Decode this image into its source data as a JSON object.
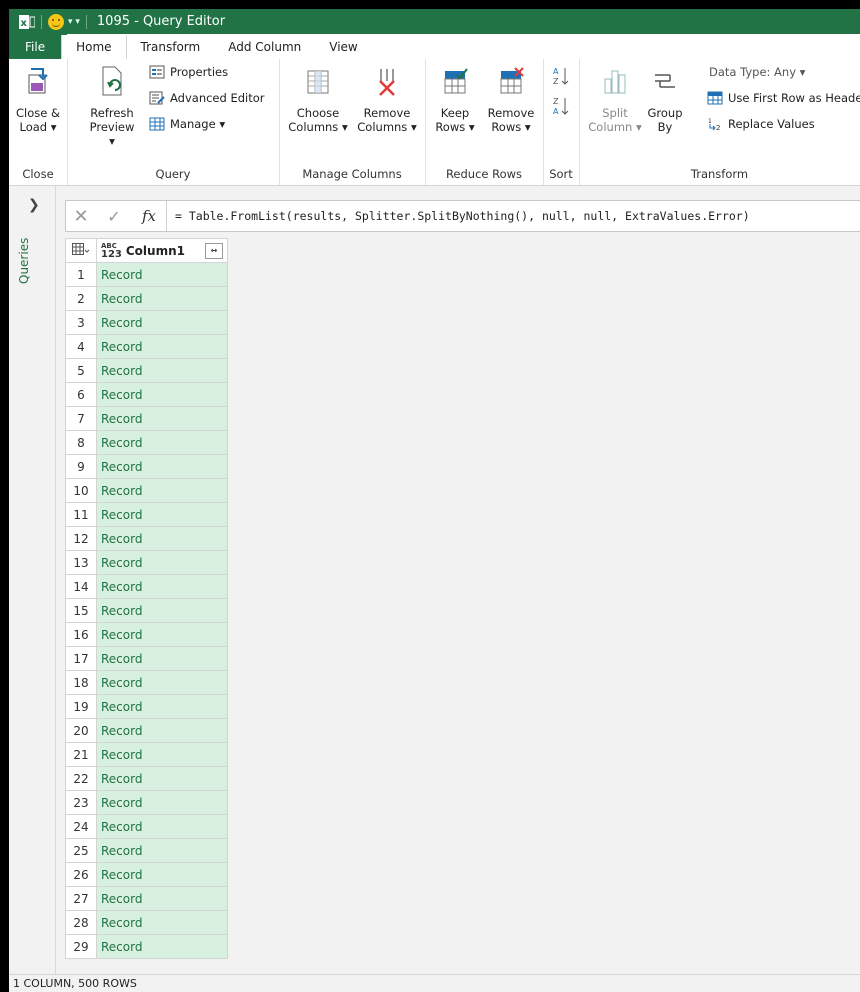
{
  "window": {
    "title": "1095 - Query Editor",
    "app_icon": "excel-icon",
    "qa_toolbar": "▾ ▾"
  },
  "tabs": [
    {
      "label": "File"
    },
    {
      "label": "Home"
    },
    {
      "label": "Transform"
    },
    {
      "label": "Add Column"
    },
    {
      "label": "View"
    }
  ],
  "ribbon": {
    "close": {
      "label": "Close",
      "close_load": "Close &",
      "close_load2": "Load ▾"
    },
    "query": {
      "label": "Query",
      "refresh": "Refresh",
      "refresh2": "Preview ▾",
      "properties": "Properties",
      "advanced_editor": "Advanced Editor",
      "manage": "Manage ▾"
    },
    "manage_columns": {
      "label": "Manage Columns",
      "choose": "Choose",
      "choose2": "Columns ▾",
      "remove": "Remove",
      "remove2": "Columns ▾"
    },
    "reduce_rows": {
      "label": "Reduce Rows",
      "keep": "Keep",
      "keep2": "Rows ▾",
      "remove": "Remove",
      "remove2": "Rows ▾"
    },
    "sort": {
      "label": "Sort"
    },
    "transform": {
      "label": "Transform",
      "split": "Split",
      "split2": "Column ▾",
      "group": "Group",
      "group2": "By",
      "data_type": "Data Type: Any ▾",
      "first_row": "Use First Row as Heade",
      "replace": "Replace Values"
    }
  },
  "queries_pane": {
    "label": "Queries"
  },
  "formula": {
    "text": "= Table.FromList(results, Splitter.SplitByNothing(), null, null, ExtraValues.Error)"
  },
  "grid": {
    "type_label_top": "ABC",
    "type_label_bottom": "123",
    "column_header": "Column1",
    "rows": [
      {
        "n": "1",
        "v": "Record"
      },
      {
        "n": "2",
        "v": "Record"
      },
      {
        "n": "3",
        "v": "Record"
      },
      {
        "n": "4",
        "v": "Record"
      },
      {
        "n": "5",
        "v": "Record"
      },
      {
        "n": "6",
        "v": "Record"
      },
      {
        "n": "7",
        "v": "Record"
      },
      {
        "n": "8",
        "v": "Record"
      },
      {
        "n": "9",
        "v": "Record"
      },
      {
        "n": "10",
        "v": "Record"
      },
      {
        "n": "11",
        "v": "Record"
      },
      {
        "n": "12",
        "v": "Record"
      },
      {
        "n": "13",
        "v": "Record"
      },
      {
        "n": "14",
        "v": "Record"
      },
      {
        "n": "15",
        "v": "Record"
      },
      {
        "n": "16",
        "v": "Record"
      },
      {
        "n": "17",
        "v": "Record"
      },
      {
        "n": "18",
        "v": "Record"
      },
      {
        "n": "19",
        "v": "Record"
      },
      {
        "n": "20",
        "v": "Record"
      },
      {
        "n": "21",
        "v": "Record"
      },
      {
        "n": "22",
        "v": "Record"
      },
      {
        "n": "23",
        "v": "Record"
      },
      {
        "n": "24",
        "v": "Record"
      },
      {
        "n": "25",
        "v": "Record"
      },
      {
        "n": "26",
        "v": "Record"
      },
      {
        "n": "27",
        "v": "Record"
      },
      {
        "n": "28",
        "v": "Record"
      },
      {
        "n": "29",
        "v": "Record"
      }
    ]
  },
  "status": {
    "text": "1 COLUMN, 500 ROWS"
  },
  "colors": {
    "accent": "#217346",
    "cell_bg": "#d7f0e0",
    "cell_text": "#217346"
  }
}
